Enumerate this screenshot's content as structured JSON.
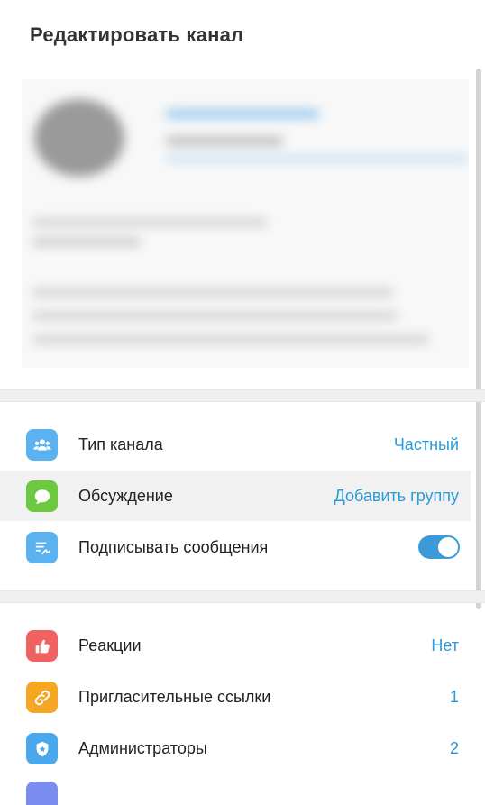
{
  "header": {
    "title": "Редактировать канал"
  },
  "settings_rows": [
    {
      "label": "Тип канала",
      "value": "Частный",
      "icon": "people-icon",
      "icon_color": "#5ab3f0"
    },
    {
      "label": "Обсуждение",
      "value": "Добавить группу",
      "icon": "chat-bubble-icon",
      "icon_color": "#6cc83f"
    },
    {
      "label": "Подписывать сообщения",
      "toggle": true,
      "icon": "signature-icon",
      "icon_color": "#5ab3f0"
    }
  ],
  "management_rows": [
    {
      "label": "Реакции",
      "value": "Нет",
      "icon": "thumbs-up-icon",
      "icon_color": "#f06262"
    },
    {
      "label": "Пригласительные ссылки",
      "value": "1",
      "icon": "link-icon",
      "icon_color": "#f5a623"
    },
    {
      "label": "Администраторы",
      "value": "2",
      "icon": "admin-badge-icon",
      "icon_color": "#4aa8ec"
    }
  ],
  "colors": {
    "accent": "#2a9bd6",
    "toggle_on": "#3d9ad8",
    "hover_row": "#f1f1f1",
    "separator": "#f0f0f0"
  }
}
